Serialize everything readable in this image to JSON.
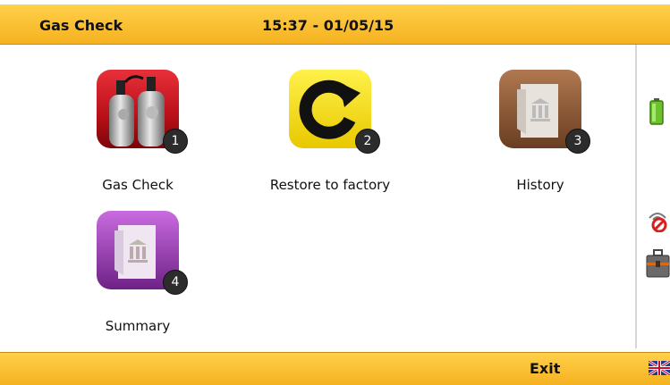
{
  "header": {
    "title": "Gas Check",
    "datetime": "15:37 - 01/05/15"
  },
  "menu": {
    "items": [
      {
        "label": "Gas Check",
        "badge": "1",
        "icon": "gas-cylinders-icon"
      },
      {
        "label": "Restore to factory",
        "badge": "2",
        "icon": "restore-icon"
      },
      {
        "label": "History",
        "badge": "3",
        "icon": "history-folder-icon"
      },
      {
        "label": "Summary",
        "badge": "4",
        "icon": "summary-folder-icon"
      }
    ]
  },
  "footer": {
    "exit_label": "Exit",
    "language_icon": "uk-flag-icon"
  },
  "status": {
    "battery_icon": "battery-icon",
    "alarm_icon": "alarm-off-icon",
    "toolbox_icon": "toolbox-icon"
  },
  "colors": {
    "bar": "#f5b220",
    "gas_check_icon": "#c4101a",
    "restore_icon": "#f6e21a",
    "history_icon": "#8a5a3c",
    "summary_icon": "#8c3aa0"
  }
}
